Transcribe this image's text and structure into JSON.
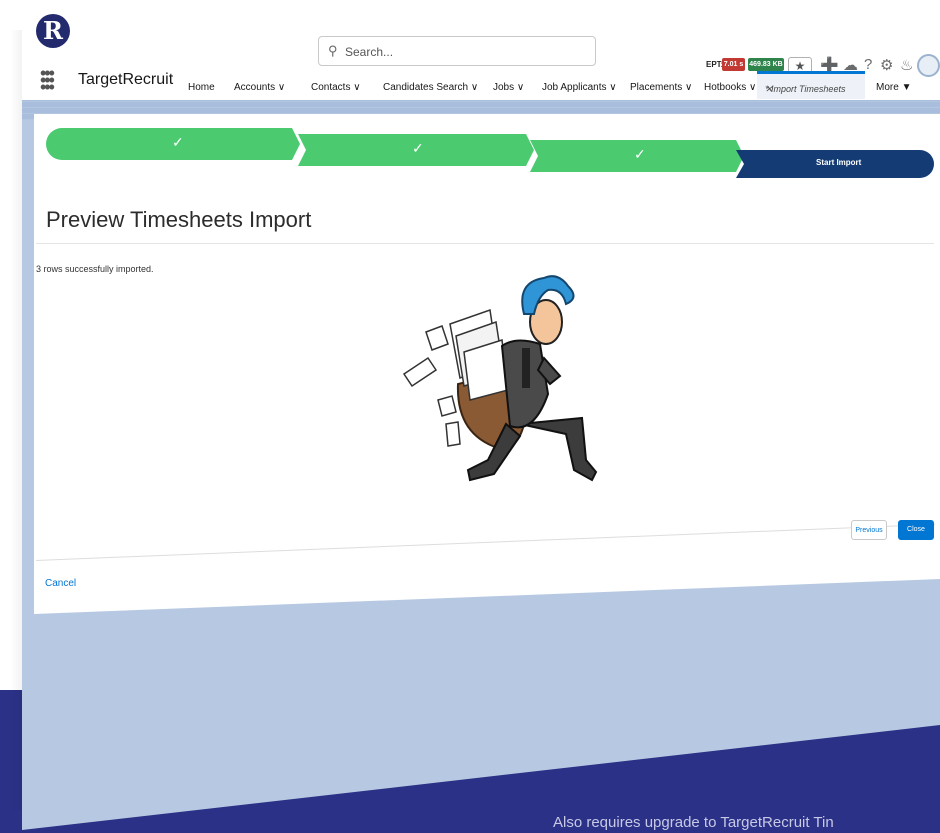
{
  "header": {
    "app_name": "TargetRecruit",
    "search_placeholder": "Search...",
    "ept_label": "EPT:",
    "ept_time": "7.01 s",
    "ept_size": "469.83 KB"
  },
  "nav": {
    "items": [
      {
        "label": "Home"
      },
      {
        "label": "Accounts"
      },
      {
        "label": "Contacts"
      },
      {
        "label": "Candidates Search"
      },
      {
        "label": "Jobs"
      },
      {
        "label": "Job Applicants"
      },
      {
        "label": "Placements"
      },
      {
        "label": "Hotbooks"
      }
    ],
    "active_tab": "* Import Timesheets",
    "more": "More"
  },
  "progress": {
    "steps_completed": 3,
    "final_step": "Start Import"
  },
  "page": {
    "title": "Preview Timesheets Import",
    "message": "3 rows successfully imported."
  },
  "footer": {
    "previous": "Previous",
    "close": "Close",
    "cancel": "Cancel"
  },
  "caption": "Also requires upgrade to TargetRecruit Tin",
  "colors": {
    "accent": "#0176d3",
    "progress_complete": "#4bca6f",
    "progress_current": "#143b73",
    "brand_navy": "#2b3186"
  }
}
